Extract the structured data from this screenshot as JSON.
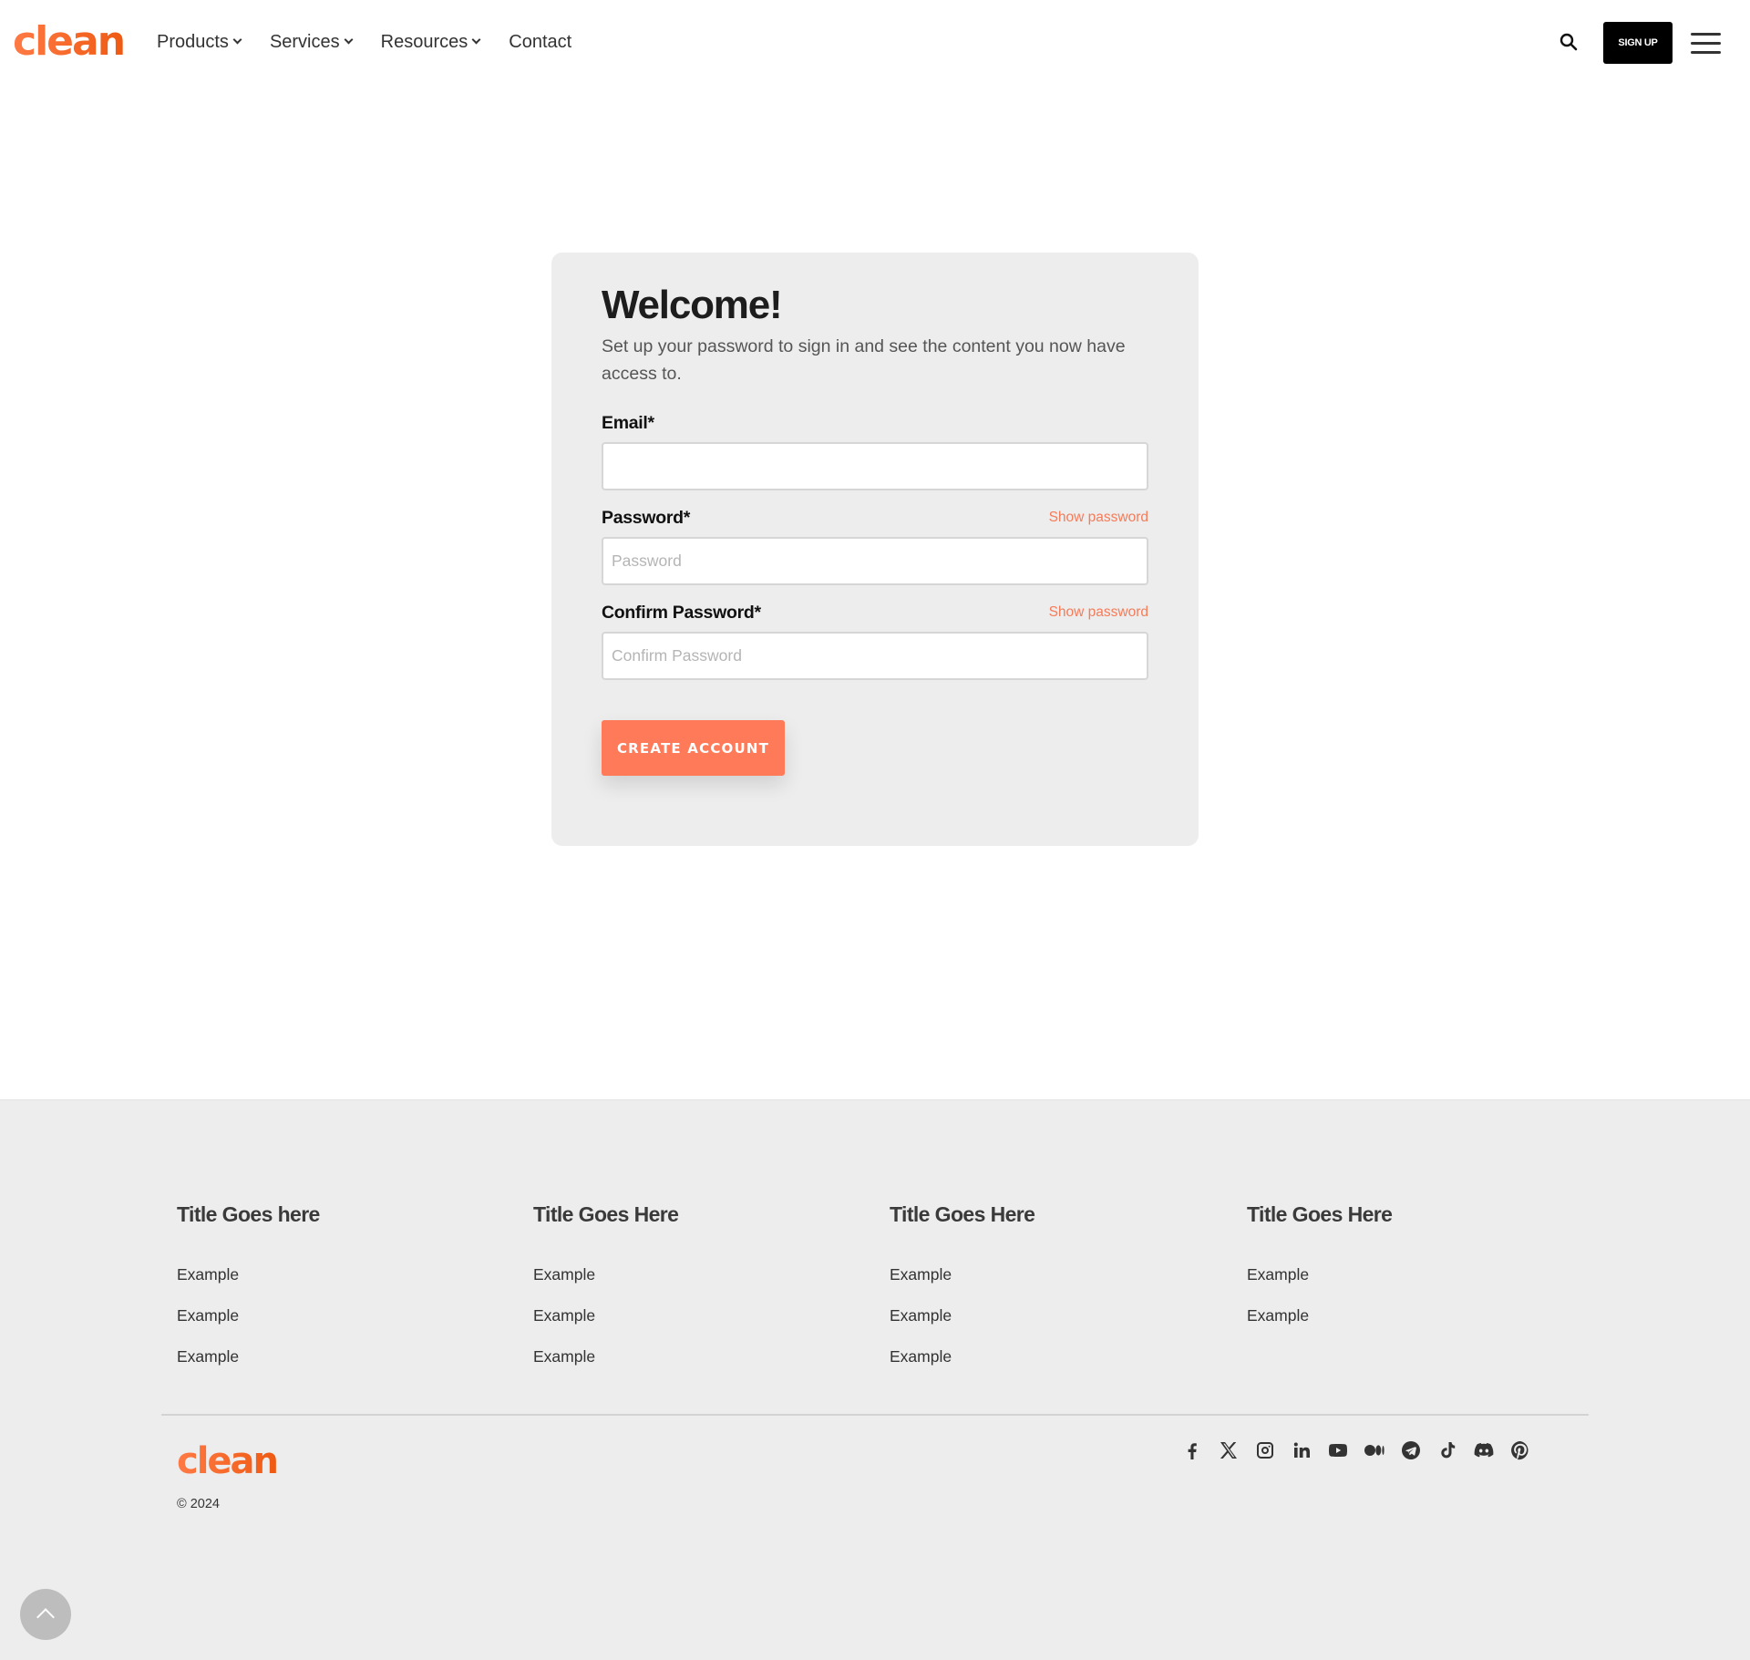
{
  "header": {
    "logo": "clean",
    "nav": [
      {
        "label": "Products",
        "has_dropdown": true
      },
      {
        "label": "Services",
        "has_dropdown": true
      },
      {
        "label": "Resources",
        "has_dropdown": true
      },
      {
        "label": "Contact",
        "has_dropdown": false
      }
    ],
    "search_icon": "search-icon",
    "signup_label": "SIGN UP",
    "menu_icon": "hamburger-menu-icon"
  },
  "form": {
    "title": "Welcome!",
    "intro": "Set up your password to sign in and see the content you now have access to.",
    "email": {
      "label": "Email*",
      "value": "",
      "placeholder": ""
    },
    "password": {
      "label": "Password*",
      "value": "",
      "placeholder": "Password",
      "show_label": "Show password"
    },
    "confirm_password": {
      "label": "Confirm Password*",
      "value": "",
      "placeholder": "Confirm Password",
      "show_label": "Show password"
    },
    "submit_label": "CREATE ACCOUNT"
  },
  "footer": {
    "columns": [
      {
        "title": "Title Goes here",
        "links": [
          "Example",
          "Example",
          "Example"
        ]
      },
      {
        "title": "Title Goes Here",
        "links": [
          "Example",
          "Example",
          "Example"
        ]
      },
      {
        "title": "Title Goes Here",
        "links": [
          "Example",
          "Example",
          "Example"
        ]
      },
      {
        "title": "Title Goes Here",
        "links": [
          "Example",
          "Example"
        ]
      }
    ],
    "logo": "clean",
    "copyright": "© 2024",
    "socials": [
      "facebook",
      "x",
      "instagram",
      "linkedin",
      "youtube",
      "medium",
      "telegram",
      "tiktok",
      "discord",
      "pinterest"
    ]
  },
  "colors": {
    "brand": "#f26522",
    "accent_button": "#ff7a59",
    "link": "#f47c5a",
    "card_bg": "#ededed",
    "footer_bg": "#ededed"
  }
}
